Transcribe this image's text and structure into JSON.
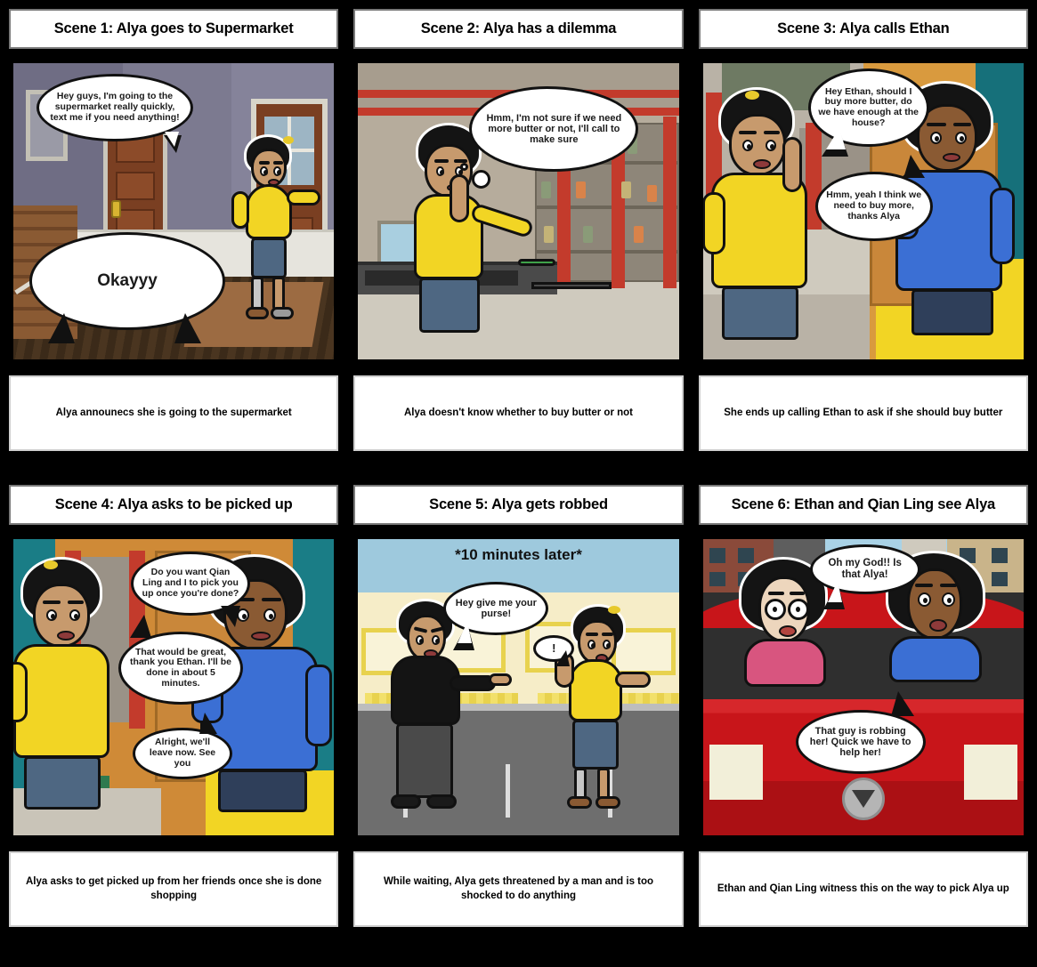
{
  "storyboard": {
    "scenes": [
      {
        "id": "scene-1",
        "title": "Scene 1: Alya goes to Supermarket",
        "caption": "Alya announecs she is going to the supermarket",
        "bubbles": [
          {
            "name": "bubble-alya-announce",
            "type": "speech",
            "text": "Hey guys, I'm going to the supermarket really quickly, text me if you need anything!"
          },
          {
            "name": "bubble-okayyy",
            "type": "speech",
            "text": "Okayyy"
          }
        ]
      },
      {
        "id": "scene-2",
        "title": "Scene 2: Alya has a dilemma",
        "caption": "Alya doesn't know whether to buy butter or not",
        "bubbles": [
          {
            "name": "bubble-alya-thought",
            "type": "thought",
            "text": "Hmm, I'm not sure if we need more butter or not, I'll call to make sure"
          }
        ]
      },
      {
        "id": "scene-3",
        "title": "Scene 3: Alya calls Ethan",
        "caption": "She ends up calling Ethan to ask if she should buy butter",
        "bubbles": [
          {
            "name": "bubble-alya-asks-butter",
            "type": "speech",
            "text": "Hey Ethan, should I buy more butter, do we have enough at the house?"
          },
          {
            "name": "bubble-ethan-replies",
            "type": "speech",
            "text": "Hmm, yeah I think we need to buy more, thanks Alya"
          }
        ]
      },
      {
        "id": "scene-4",
        "title": "Scene 4: Alya asks to be picked up",
        "caption": "Alya asks to get picked up from her friends once she is done shopping",
        "bubbles": [
          {
            "name": "bubble-ethan-offer-pickup",
            "type": "speech",
            "text": "Do you want Qian Ling and I to pick you up once you're done?"
          },
          {
            "name": "bubble-alya-accepts",
            "type": "speech",
            "text": "That would be great, thank you Ethan. I'll be done in about 5 minutes."
          },
          {
            "name": "bubble-ethan-leaving",
            "type": "speech",
            "text": "Alright, we'll leave now. See you"
          }
        ]
      },
      {
        "id": "scene-5",
        "title": "Scene 5: Alya gets robbed",
        "caption": "While waiting, Alya gets threatened by a man and is too shocked to do anything",
        "time_card": "*10 minutes later*",
        "bubbles": [
          {
            "name": "bubble-robber-demand",
            "type": "speech",
            "text": "Hey give me your purse!"
          },
          {
            "name": "bubble-alya-shock",
            "type": "speech",
            "text": "!"
          }
        ]
      },
      {
        "id": "scene-6",
        "title": "Scene 6: Ethan and Qian Ling see Alya",
        "caption": "Ethan and Qian Ling witness this on the way to pick Alya up",
        "bubbles": [
          {
            "name": "bubble-qianling-sees",
            "type": "speech",
            "text": "Oh my God!! Is that Alya!"
          },
          {
            "name": "bubble-ethan-robbing",
            "type": "speech",
            "text": "That guy is robbing her! Quick we have to help her!"
          }
        ]
      }
    ]
  },
  "colors": {
    "background": "#000000",
    "panel_border": "#000000",
    "title_background": "#ffffff",
    "caption_background": "#ffffff",
    "alya_shirt": "#f2d524",
    "ethan_shirt": "#3b6fd4",
    "qianling_shirt": "#d8557f",
    "car_body": "#c8151a",
    "robber_outfit": "#1a1a1a"
  }
}
